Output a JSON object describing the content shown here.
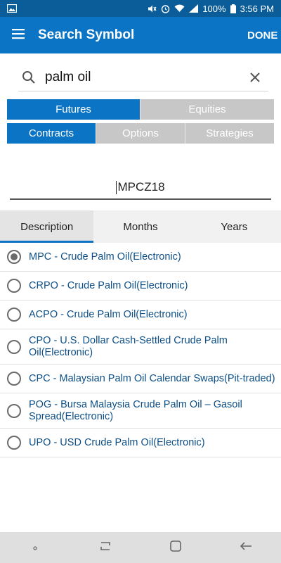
{
  "status_bar": {
    "battery": "100%",
    "time": "3:56 PM"
  },
  "app_bar": {
    "title": "Search Symbol",
    "done_label": "DONE"
  },
  "search": {
    "value": "palm oil"
  },
  "primary_segments": [
    {
      "label": "Futures",
      "active": true
    },
    {
      "label": "Equities",
      "active": false
    }
  ],
  "secondary_segments": [
    {
      "label": "Contracts",
      "active": true
    },
    {
      "label": "Options",
      "active": false
    },
    {
      "label": "Strategies",
      "active": false
    }
  ],
  "contract_field": {
    "value": "MPCZ18"
  },
  "tabs": [
    {
      "label": "Description",
      "active": true
    },
    {
      "label": "Months",
      "active": false
    },
    {
      "label": "Years",
      "active": false
    }
  ],
  "results": [
    {
      "label": "MPC - Crude Palm Oil(Electronic)",
      "selected": true
    },
    {
      "label": "CRPO - Crude Palm Oil(Electronic)",
      "selected": false
    },
    {
      "label": "ACPO - Crude Palm Oil(Electronic)",
      "selected": false
    },
    {
      "label": "CPO - U.S. Dollar Cash-Settled Crude Palm Oil(Electronic)",
      "selected": false
    },
    {
      "label": "CPC - Malaysian Palm Oil Calendar Swaps(Pit-traded)",
      "selected": false
    },
    {
      "label": "POG - Bursa Malaysia Crude Palm Oil – Gasoil Spread(Electronic)",
      "selected": false
    },
    {
      "label": "UPO - USD Crude Palm Oil(Electronic)",
      "selected": false
    }
  ],
  "colors": {
    "primary": "#0b74c5",
    "status_bar": "#0a5d99",
    "segment_inactive": "#c7c7c7",
    "link_text": "#0d4f86"
  },
  "icons": [
    "gallery-icon",
    "mute-icon",
    "alarm-icon",
    "wifi-icon",
    "signal-icon",
    "battery-icon",
    "menu-icon",
    "search-icon",
    "clear-icon",
    "recents-icon",
    "home-icon",
    "back-icon"
  ]
}
